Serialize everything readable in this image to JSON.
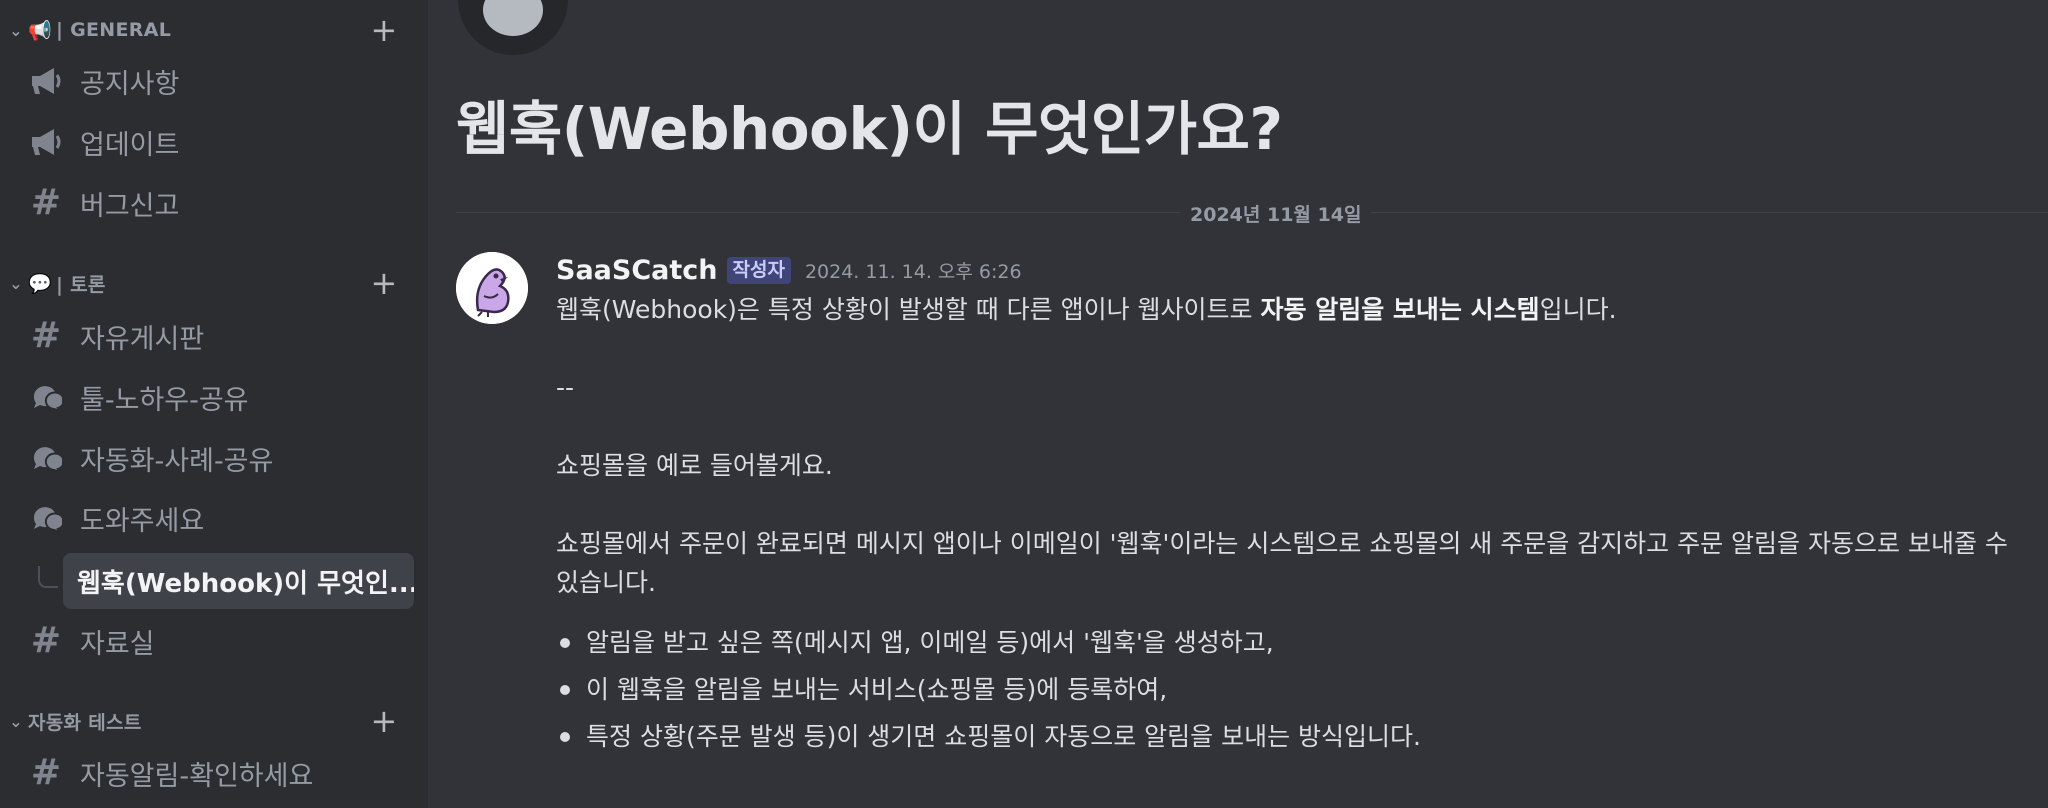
{
  "sidebar": {
    "categories": [
      {
        "label": "| GENERAL",
        "emoji": "📢",
        "plus": "+"
      },
      {
        "label": "| 토론",
        "emoji": "💬",
        "plus": "+"
      },
      {
        "label": "자동화 테스트",
        "plus": "+"
      }
    ],
    "general_channels": [
      {
        "label": "공지사항",
        "icon": "megaphone-icon"
      },
      {
        "label": "업데이트",
        "icon": "megaphone-icon"
      },
      {
        "label": "버그신고",
        "icon": "hash-icon"
      }
    ],
    "discussion_channels": [
      {
        "label": "자유게시판",
        "icon": "hash-icon"
      },
      {
        "label": "툴-노하우-공유",
        "icon": "forum-icon"
      },
      {
        "label": "자동화-사례-공유",
        "icon": "forum-icon"
      },
      {
        "label": "도와주세요",
        "icon": "forum-icon"
      }
    ],
    "active_thread": "웹훅(Webhook)이 무엇인...",
    "after_thread_channel": {
      "label": "자료실",
      "icon": "hash-icon"
    },
    "test_channels": [
      {
        "label": "자동알림-확인하세요",
        "icon": "hash-icon"
      }
    ],
    "hash_glyph": "#"
  },
  "post": {
    "title": "웹훅(Webhook)이 무엇인가요?",
    "date_divider": "2024년 11월 14일",
    "author": "SaaSCatch",
    "author_tag": "작성자",
    "timestamp": "2024. 11. 14. 오후 6:26",
    "line1_prefix": "웹훅(Webhook)은 특정 상황이 발생할 때 다른 앱이나 웹사이트로 ",
    "line1_bold": "자동 알림을 보내는 시스템",
    "line1_suffix": "입니다.",
    "separator": "--",
    "line2": "쇼핑몰을 예로 들어볼게요.",
    "line3": "쇼핑몰에서 주문이 완료되면 메시지 앱이나 이메일이 '웹훅'이라는 시스템으로 쇼핑몰의 새 주문을 감지하고 주문 알림을 자동으로 보내줄 수 있습니다.",
    "bullets": [
      "알림을 받고 싶은 쪽(메시지 앱, 이메일 등)에서 '웹훅'을 생성하고,",
      "이 웹훅을 알림을 보내는 서비스(쇼핑몰 등)에 등록하여,",
      "특정 상황(주문 발생 등)이 생기면 쇼핑몰이 자동으로 알림을 보내는 방식입니다."
    ]
  },
  "colors": {
    "sidebar_bg": "#2b2d31",
    "main_bg": "#323339",
    "selected_bg": "#404249",
    "tag_text": "#c9cdfb",
    "muted_text": "#949ba4"
  }
}
